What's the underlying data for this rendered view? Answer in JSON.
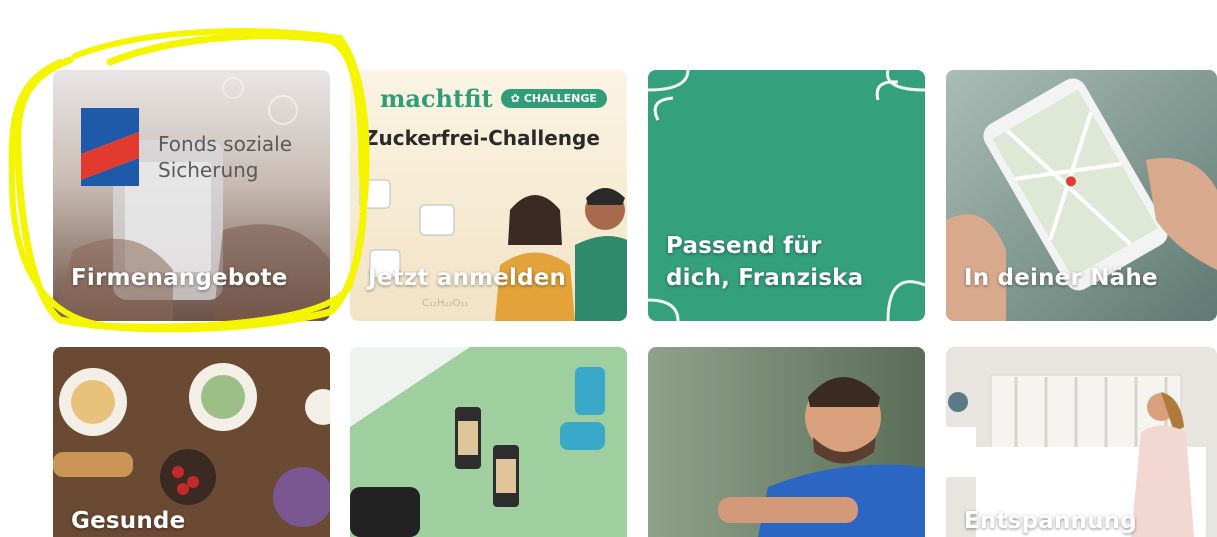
{
  "tiles": [
    {
      "label": "Firmenangebote",
      "logo_line1": "Fonds soziale",
      "logo_line2": "Sicherung",
      "logo_colors": {
        "blue": "#1f5aa8",
        "red": "#e23a2e"
      },
      "highlighted": true
    },
    {
      "label": "Jetzt anmelden",
      "brand": "machtfit",
      "badge": "CHALLENGE",
      "title": "Zuckerfrei-Challenge",
      "formula": "C₁₂H₂₂O₁₁"
    },
    {
      "label_line1": "Passend für",
      "label_line2": "dich, Franziska",
      "color": "#34a07c"
    },
    {
      "label": "In deiner Nähe"
    },
    {
      "label": "Gesunde"
    },
    {
      "label": ""
    },
    {
      "label": ""
    },
    {
      "label": "Entspannung"
    }
  ],
  "colors": {
    "machtfit_green": "#2f9e78",
    "highlight_yellow": "#f5f500"
  }
}
